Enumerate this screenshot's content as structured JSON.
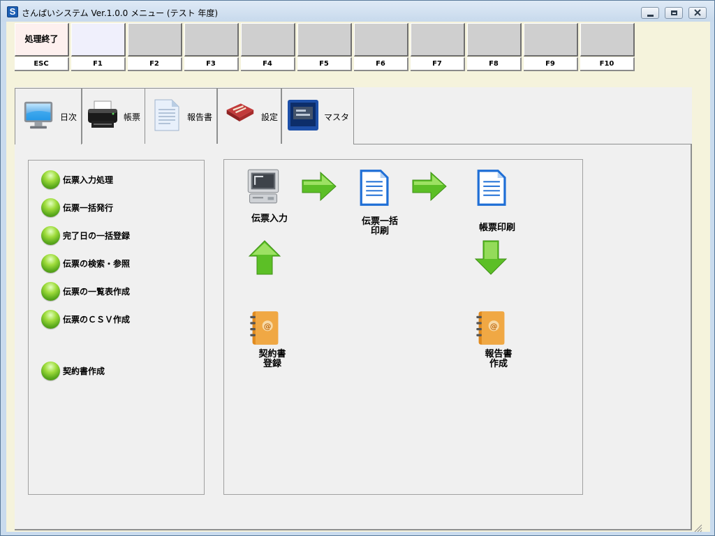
{
  "window": {
    "title": "さんぱいシステム Ver.1.0.0 メニュー (テスト 年度)"
  },
  "function_keys": [
    {
      "caption": "処理終了",
      "label": "ESC"
    },
    {
      "caption": "",
      "label": "F1"
    },
    {
      "caption": "",
      "label": "F2"
    },
    {
      "caption": "",
      "label": "F3"
    },
    {
      "caption": "",
      "label": "F4"
    },
    {
      "caption": "",
      "label": "F5"
    },
    {
      "caption": "",
      "label": "F6"
    },
    {
      "caption": "",
      "label": "F7"
    },
    {
      "caption": "",
      "label": "F8"
    },
    {
      "caption": "",
      "label": "F9"
    },
    {
      "caption": "",
      "label": "F10"
    }
  ],
  "tabs": [
    {
      "label": "日次",
      "icon": "monitor-icon",
      "active": true
    },
    {
      "label": "帳票",
      "icon": "printer-icon",
      "active": false
    },
    {
      "label": "報告書",
      "icon": "document-icon",
      "active": false
    },
    {
      "label": "設定",
      "icon": "book-tools-icon",
      "active": false
    },
    {
      "label": "マスタ",
      "icon": "master-screen-icon",
      "active": false
    }
  ],
  "menu_items": [
    "伝票入力処理",
    "伝票一括発行",
    "完了日の一括登録",
    "伝票の検索・参照",
    "伝票の一覧表作成",
    "伝票のＣＳＶ作成",
    "契約書作成"
  ],
  "flow": {
    "slip_input": {
      "label": "伝票入力",
      "icon": "computer-icon"
    },
    "bulk_print": {
      "label": "伝票一括\n印刷",
      "icon": "document-icon"
    },
    "form_print": {
      "label": "帳票印刷",
      "icon": "document-icon"
    },
    "contract_register": {
      "label": "契約書\n登録",
      "icon": "address-book-icon"
    },
    "report_create": {
      "label": "報告書\n作成",
      "icon": "address-book-icon"
    }
  },
  "colors": {
    "client_bg": "#f5f3dc",
    "panel_bg": "#f0f0f0",
    "arrow_green": "#5cbf26",
    "esc_key_bg": "#fdf0ee",
    "f1_key_bg": "#f0f0fc"
  }
}
